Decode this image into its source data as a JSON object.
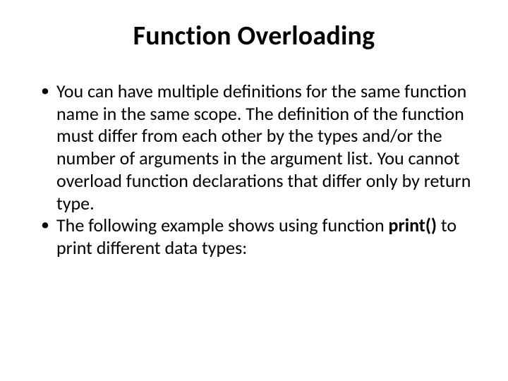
{
  "slide": {
    "title": "Function Overloading",
    "bullets": [
      {
        "text": "You can have multiple definitions for the same function name in the same scope. The definition of the function must differ from each other by the types and/or the number of arguments in the argument list. You cannot overload function declarations that differ only by return type."
      },
      {
        "prefix": "The following example shows using function ",
        "bold": "print()",
        "suffix": " to print different data types:"
      }
    ]
  }
}
